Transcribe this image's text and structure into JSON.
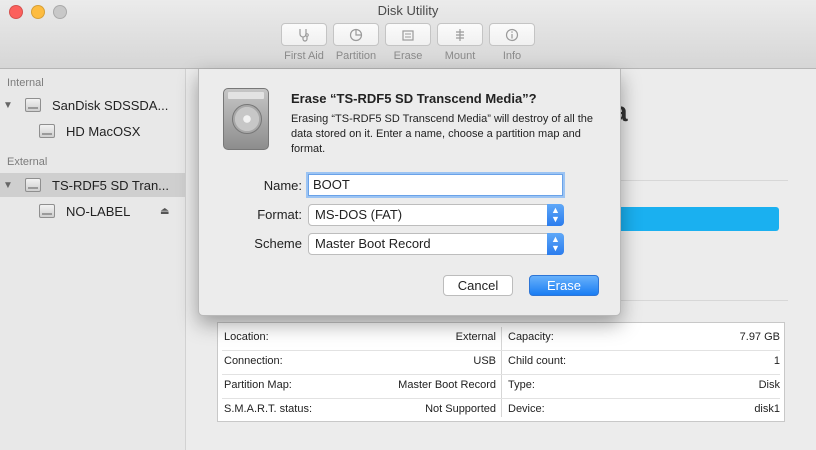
{
  "window": {
    "title": "Disk Utility",
    "traffic_lights": {
      "close": "#fc605c",
      "minimize": "#fdbc40",
      "zoom": "#c8c8c8"
    }
  },
  "toolbar": {
    "items": [
      {
        "label": "First Aid",
        "icon": "stethoscope-icon"
      },
      {
        "label": "Partition",
        "icon": "pie-chart-icon"
      },
      {
        "label": "Erase",
        "icon": "erase-icon"
      },
      {
        "label": "Mount",
        "icon": "mount-icon"
      },
      {
        "label": "Info",
        "icon": "info-icon"
      }
    ]
  },
  "sidebar": {
    "sections": [
      {
        "header": "Internal",
        "items": [
          {
            "label": "SanDisk SDSSDA...",
            "level": 0,
            "selected": false
          },
          {
            "label": "HD MacOSX",
            "level": 1,
            "selected": false
          }
        ]
      },
      {
        "header": "External",
        "items": [
          {
            "label": "TS-RDF5 SD Tran...",
            "level": 0,
            "selected": true
          },
          {
            "label": "NO-LABEL",
            "level": 1,
            "selected": false,
            "eject": true
          }
        ]
      }
    ]
  },
  "background": {
    "title_fragment": "a"
  },
  "dialog": {
    "title": "Erase “TS-RDF5 SD Transcend Media”?",
    "message": "Erasing “TS-RDF5 SD Transcend Media” will destroy of all the data stored on it. Enter a name, choose a partition map and format.",
    "name_label": "Name:",
    "name_value": "BOOT",
    "format_label": "Format:",
    "format_value": "MS-DOS (FAT)",
    "scheme_label": "Scheme",
    "scheme_value": "Master Boot Record",
    "cancel_label": "Cancel",
    "erase_label": "Erase",
    "accent": "#1a7df3"
  },
  "info": {
    "rows": [
      {
        "left_label": "Location:",
        "left_value": "External",
        "right_label": "Capacity:",
        "right_value": "7.97 GB"
      },
      {
        "left_label": "Connection:",
        "left_value": "USB",
        "right_label": "Child count:",
        "right_value": "1"
      },
      {
        "left_label": "Partition Map:",
        "left_value": "Master Boot Record",
        "right_label": "Type:",
        "right_value": "Disk"
      },
      {
        "left_label": "S.M.A.R.T. status:",
        "left_value": "Not Supported",
        "right_label": "Device:",
        "right_value": "disk1"
      }
    ]
  }
}
